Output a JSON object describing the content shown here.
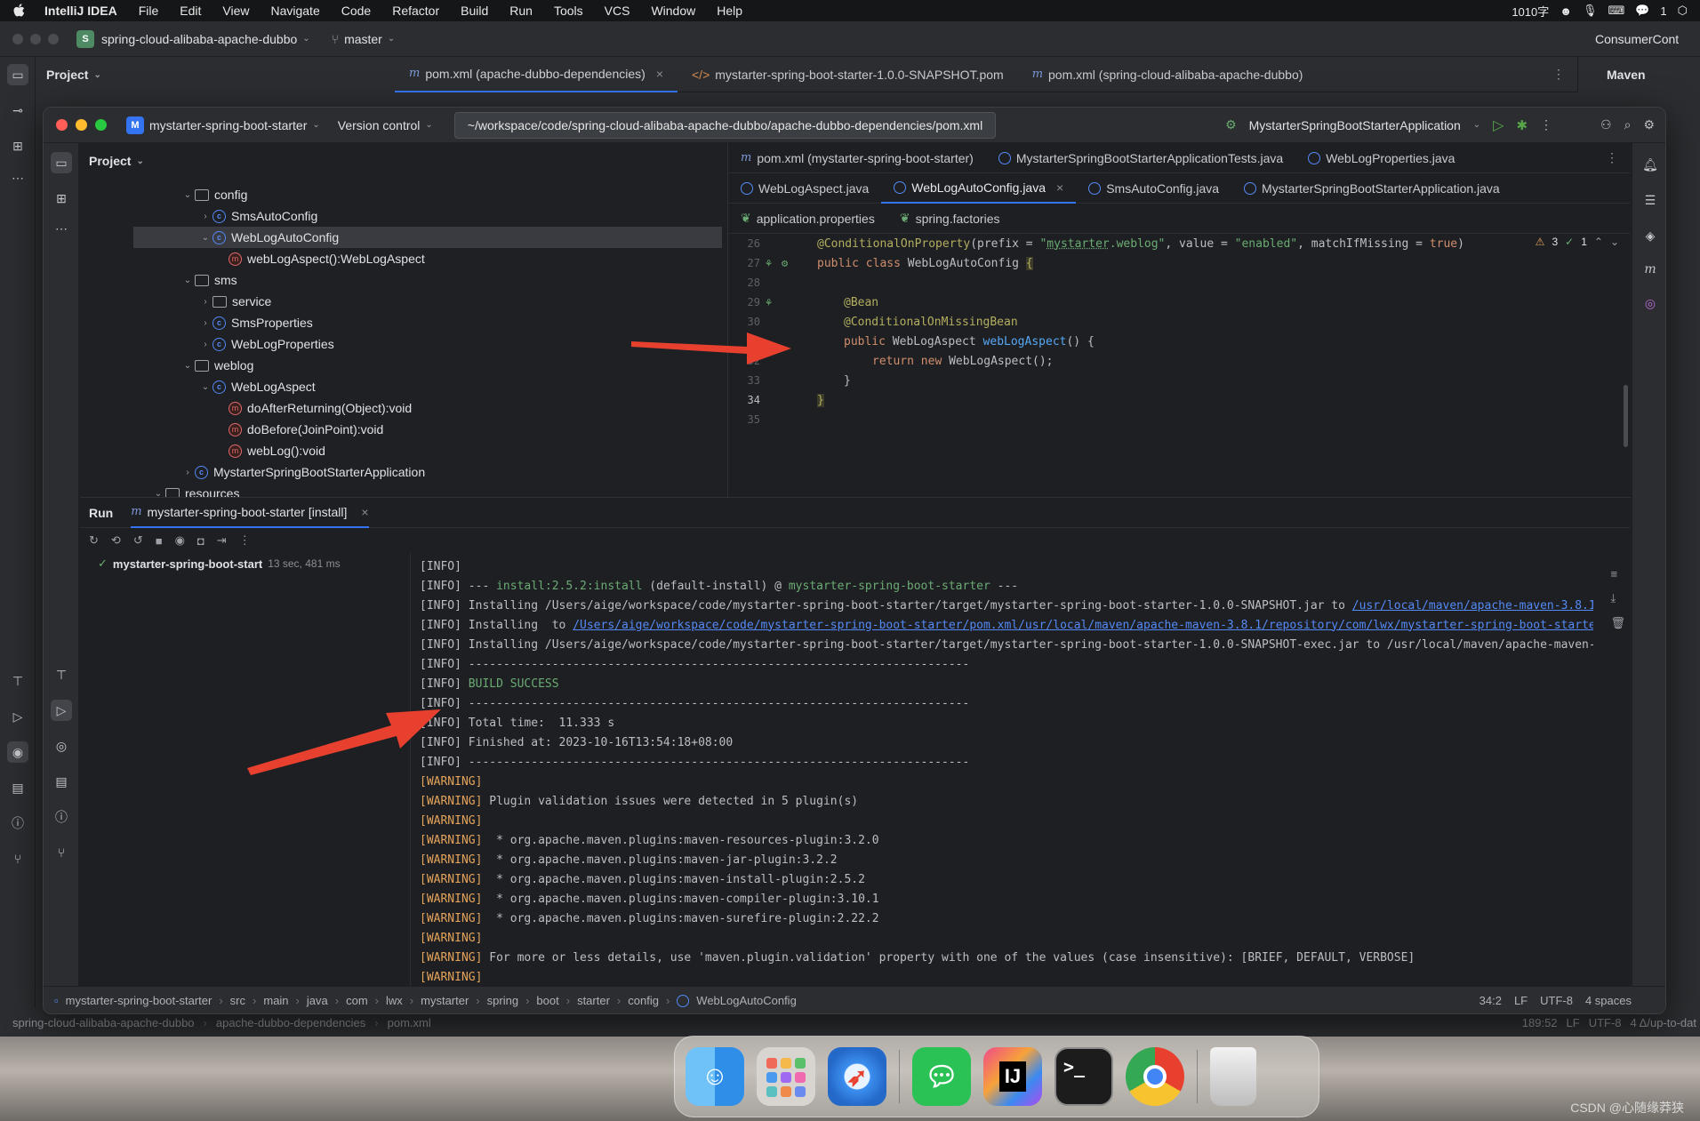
{
  "menubar": {
    "app_name": "IntelliJ IDEA",
    "items": [
      "File",
      "Edit",
      "View",
      "Navigate",
      "Code",
      "Refactor",
      "Build",
      "Run",
      "Tools",
      "VCS",
      "Window",
      "Help"
    ],
    "status_text": "1010字",
    "wechat_count": "1"
  },
  "outer_ide": {
    "project_badge": "S",
    "project_name": "spring-cloud-alibaba-apache-dubbo",
    "branch": "master",
    "right_tab": "ConsumerCont",
    "project_label": "Project",
    "tabs": [
      "pom.xml (apache-dubbo-dependencies)",
      "mystarter-spring-boot-starter-1.0.0-SNAPSHOT.pom",
      "pom.xml (spring-cloud-alibaba-apache-dubbo)"
    ],
    "maven_label": "Maven",
    "status_path": [
      "spring-cloud-alibaba-apache-dubbo",
      "apache-dubbo-dependencies",
      "pom.xml"
    ],
    "status_right": [
      "189:52",
      "LF",
      "UTF-8",
      "4 Δ/up-to-dat"
    ]
  },
  "window": {
    "project_badge": "M",
    "project_name": "mystarter-spring-boot-starter",
    "version_control": "Version control",
    "path_tooltip": "~/workspace/code/spring-cloud-alibaba-apache-dubbo/apache-dubbo-dependencies/pom.xml",
    "run_config": "MystarterSpringBootStarterApplication"
  },
  "project_panel": {
    "title": "Project",
    "rows": [
      {
        "label": "config",
        "kind": "folder",
        "expanded": true
      },
      {
        "label": "SmsAutoConfig",
        "kind": "class",
        "expanded": false
      },
      {
        "label": "WebLogAutoConfig",
        "kind": "class",
        "expanded": true
      },
      {
        "label": "webLogAspect():WebLogAspect",
        "kind": "method"
      },
      {
        "label": "sms",
        "kind": "folder",
        "expanded": true
      },
      {
        "label": "service",
        "kind": "folder",
        "expanded": false
      },
      {
        "label": "SmsProperties",
        "kind": "class",
        "expanded": false
      },
      {
        "label": "WebLogProperties",
        "kind": "class",
        "expanded": false
      },
      {
        "label": "weblog",
        "kind": "folder",
        "expanded": true
      },
      {
        "label": "WebLogAspect",
        "kind": "class",
        "expanded": true
      },
      {
        "label": "doAfterReturning(Object):void",
        "kind": "method"
      },
      {
        "label": "doBefore(JoinPoint):void",
        "kind": "method"
      },
      {
        "label": "webLog():void",
        "kind": "method"
      },
      {
        "label": "MystarterSpringBootStarterApplication",
        "kind": "class",
        "expanded": false
      },
      {
        "label": "resources",
        "kind": "folder",
        "expanded": true
      }
    ]
  },
  "editor": {
    "tabs_row1": [
      "pom.xml (mystarter-spring-boot-starter)",
      "MystarterSpringBootStarterApplicationTests.java",
      "WebLogProperties.java"
    ],
    "tabs_row2": [
      "WebLogAspect.java",
      "WebLogAutoConfig.java",
      "SmsAutoConfig.java",
      "MystarterSpringBootStarterApplication.java"
    ],
    "tabs_row3": [
      "application.properties",
      "spring.factories"
    ],
    "active_tab": "WebLogAutoConfig.java",
    "inspections": {
      "warnings": "3",
      "ok": "1"
    },
    "line_numbers": [
      "26",
      "27",
      "28",
      "29",
      "30",
      "31",
      "32",
      "33",
      "34",
      "35"
    ],
    "code": {
      "l26_annotation": "@ConditionalOnProperty",
      "l26_p1": "(prefix = ",
      "l26_q1": "\"",
      "l26_s1a": "mystarter",
      "l26_s1b": ".weblog\"",
      "l26_p2": ", value = ",
      "l26_s2": "\"enabled\"",
      "l26_p3": ", matchIfMissing = ",
      "l26_kw": "true",
      "l26_p4": ")",
      "l27_kw1": "public",
      "l27_kw2": "class",
      "l27_name": " WebLogAutoConfig ",
      "l27_brace": "{",
      "l29": "@Bean",
      "l30": "@ConditionalOnMissingBean",
      "l31_kw": "public",
      "l31_type": " WebLogAspect ",
      "l31_fn": "webLogAspect",
      "l31_rest": "() {",
      "l32_kw1": "return",
      "l32_kw2": "new",
      "l32_rest": " WebLogAspect();",
      "l33": "}",
      "l34": "}"
    }
  },
  "run_panel": {
    "title": "Run",
    "tab": "mystarter-spring-boot-starter [install]",
    "tree_item": "mystarter-spring-boot-start",
    "tree_time": "13 sec, 481 ms",
    "console": [
      {
        "t": "[INFO]"
      },
      {
        "t": "[INFO] --- ",
        "g": "install:2.5.2:install",
        "r": " (default-install) @ ",
        "b": "mystarter-spring-boot-starter",
        "e": " ---"
      },
      {
        "t": "[INFO] Installing /Users/aige/workspace/code/mystarter-spring-boot-starter/target/mystarter-spring-boot-starter-1.0.0-SNAPSHOT.jar to ",
        "link": "/usr/local/maven/apache-maven-3.8.1/repository"
      },
      {
        "t": "[INFO] Installing ",
        "link": "/Users/aige/workspace/code/mystarter-spring-boot-starter/pom.xml",
        "r": " to ",
        "link2": "/usr/local/maven/apache-maven-3.8.1/repository/com/lwx/mystarter-spring-boot-starter/1.0.0-SNA"
      },
      {
        "t": "[INFO] Installing /Users/aige/workspace/code/mystarter-spring-boot-starter/target/mystarter-spring-boot-starter-1.0.0-SNAPSHOT-exec.jar to /usr/local/maven/apache-maven-3.8.1/repos"
      },
      {
        "t": "[INFO] ------------------------------------------------------------------------"
      },
      {
        "t": "[INFO] ",
        "g": "BUILD SUCCESS"
      },
      {
        "t": "[INFO] ------------------------------------------------------------------------"
      },
      {
        "t": "[INFO] Total time:  11.333 s"
      },
      {
        "t": "[INFO] Finished at: 2023-10-16T13:54:18+08:00"
      },
      {
        "t": "[INFO] ------------------------------------------------------------------------"
      },
      {
        "t": "[WARNING]"
      },
      {
        "t": "[WARNING] Plugin validation issues were detected in 5 plugin(s)"
      },
      {
        "t": "[WARNING]"
      },
      {
        "t": "[WARNING]  * org.apache.maven.plugins:maven-resources-plugin:3.2.0"
      },
      {
        "t": "[WARNING]  * org.apache.maven.plugins:maven-jar-plugin:3.2.2"
      },
      {
        "t": "[WARNING]  * org.apache.maven.plugins:maven-install-plugin:2.5.2"
      },
      {
        "t": "[WARNING]  * org.apache.maven.plugins:maven-compiler-plugin:3.10.1"
      },
      {
        "t": "[WARNING]  * org.apache.maven.plugins:maven-surefire-plugin:2.22.2"
      },
      {
        "t": "[WARNING]"
      },
      {
        "t": "[WARNING] For more or less details, use 'maven.plugin.validation' property with one of the values (case insensitive): [BRIEF, DEFAULT, VERBOSE]"
      },
      {
        "t": "[WARNING]"
      }
    ]
  },
  "breadcrumb": {
    "items": [
      "mystarter-spring-boot-starter",
      "src",
      "main",
      "java",
      "com",
      "lwx",
      "mystarter",
      "spring",
      "boot",
      "starter",
      "config",
      "WebLogAutoConfig"
    ],
    "position": "34:2",
    "line_sep": "LF",
    "encoding": "UTF-8",
    "indent": "4 spaces"
  },
  "dock": {
    "apps": [
      "finder-icon",
      "launchpad-icon",
      "safari-icon",
      "wechat-icon",
      "intellij-icon",
      "terminal-icon",
      "chrome-icon",
      "trash-icon"
    ],
    "intellij_label": "IJ",
    "terminal_label": ">_"
  },
  "watermark": "CSDN @心随缘莽狭"
}
